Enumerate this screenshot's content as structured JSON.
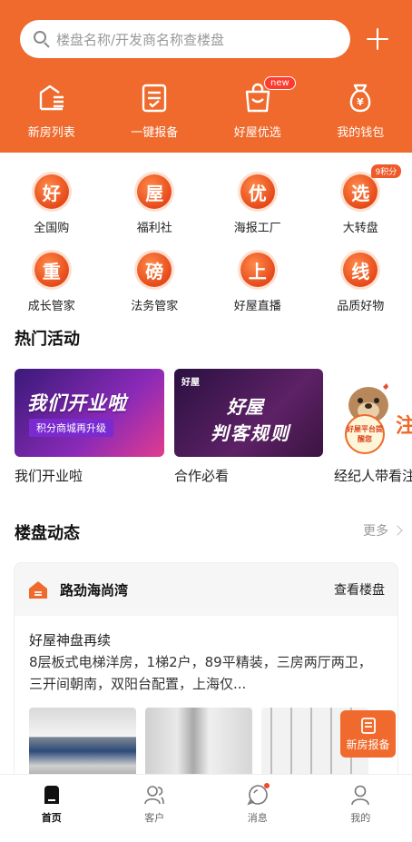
{
  "search": {
    "placeholder": "楼盘名称/开发商名称查楼盘"
  },
  "header": {
    "quick_actions": [
      {
        "label": "新房列表",
        "icon": "building-list-icon"
      },
      {
        "label": "一键报备",
        "icon": "report-form-icon"
      },
      {
        "label": "好屋优选",
        "icon": "shopping-bag-icon",
        "badge": "new"
      },
      {
        "label": "我的钱包",
        "icon": "money-bag-icon"
      }
    ]
  },
  "grid": {
    "items": [
      {
        "glyph": "好",
        "label": "全国购"
      },
      {
        "glyph": "屋",
        "label": "福利社"
      },
      {
        "glyph": "优",
        "label": "海报工厂"
      },
      {
        "glyph": "选",
        "label": "大转盘",
        "badge": "9积分"
      },
      {
        "glyph": "重",
        "label": "成长管家"
      },
      {
        "glyph": "磅",
        "label": "法务管家"
      },
      {
        "glyph": "上",
        "label": "好屋直播"
      },
      {
        "glyph": "线",
        "label": "品质好物"
      }
    ]
  },
  "hot": {
    "title": "热门活动",
    "banners": [
      {
        "label": "我们开业啦",
        "art_title": "我们开业啦",
        "art_sub": "积分商城再升级"
      },
      {
        "label": "合作必看",
        "art_logo": "好屋",
        "art_line1": "好屋",
        "art_line2": "判客规则"
      },
      {
        "label": "经纪人带看注",
        "art_tag": "好屋平台提醒您",
        "art_text": "注"
      }
    ]
  },
  "dynamics": {
    "title": "楼盘动态",
    "more": "更多",
    "card": {
      "name": "路劲海尚湾",
      "link": "查看楼盘",
      "subtitle": "好屋神盘再续",
      "description": "8层板式电梯洋房，1梯2户，89平精装，三房两厅两卫，三开间朝南，双阳台配置，上海仅..."
    }
  },
  "float_button": {
    "label": "新房报备"
  },
  "tabbar": {
    "tabs": [
      {
        "label": "首页",
        "active": true
      },
      {
        "label": "客户"
      },
      {
        "label": "消息"
      },
      {
        "label": "我的"
      }
    ]
  },
  "colors": {
    "accent": "#ef6a2c",
    "badge_red": "#ff3b30"
  }
}
